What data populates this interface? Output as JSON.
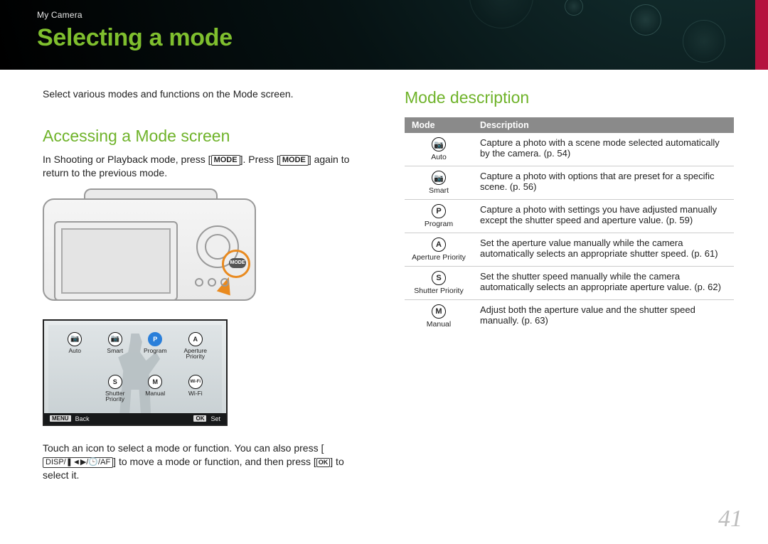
{
  "header": {
    "breadcrumb": "My Camera",
    "title": "Selecting a mode"
  },
  "left": {
    "lead": "Select various modes and functions on the Mode screen.",
    "h2": "Accessing a Mode screen",
    "para1_a": "In Shooting or Playback mode, press [",
    "para1_b": "]. Press [",
    "para1_c": "] again to return to the previous mode.",
    "mode_label": "MODE",
    "screen": {
      "items_row1": [
        {
          "icon": "cam",
          "label": "Auto"
        },
        {
          "icon": "cam",
          "label": "Smart"
        },
        {
          "icon": "P",
          "label": "Program",
          "selected": true
        },
        {
          "icon": "A",
          "label": "Aperture Priority"
        }
      ],
      "items_row2": [
        {
          "icon": "S",
          "label": "Shutter Priority"
        },
        {
          "icon": "M",
          "label": "Manual"
        },
        {
          "icon": "Wi-Fi",
          "label": "Wi-Fi"
        }
      ],
      "foot_menu": "MENU",
      "foot_back": "Back",
      "foot_ok": "OK",
      "foot_set": "Set"
    },
    "para2_a": "Touch an icon to select a mode or function. You can also press [",
    "nav_tokens": "DISP/❚◄▶/🕒/AF",
    "para2_b": "] to move a mode or function, and then press [",
    "ok": "OK",
    "para2_c": "] to select it."
  },
  "right": {
    "h2": "Mode description",
    "th_mode": "Mode",
    "th_desc": "Description",
    "rows": [
      {
        "icon": "cam",
        "name": "Auto",
        "desc": "Capture a photo with a scene mode selected automatically by the camera. (p. 54)"
      },
      {
        "icon": "cam",
        "name": "Smart",
        "desc": "Capture a photo with options that are preset for a specific scene. (p. 56)"
      },
      {
        "icon": "P",
        "name": "Program",
        "desc": "Capture a photo with settings you have adjusted manually except the shutter speed and aperture value. (p. 59)"
      },
      {
        "icon": "A",
        "name": "Aperture Priority",
        "desc": "Set the aperture value manually while the camera automatically selects an appropriate shutter speed. (p. 61)"
      },
      {
        "icon": "S",
        "name": "Shutter Priority",
        "desc": "Set the shutter speed manually while the camera automatically selects an appropriate aperture value. (p. 62)"
      },
      {
        "icon": "M",
        "name": "Manual",
        "desc": "Adjust both the aperture value and the shutter speed manually. (p. 63)"
      }
    ]
  },
  "page_number": "41"
}
